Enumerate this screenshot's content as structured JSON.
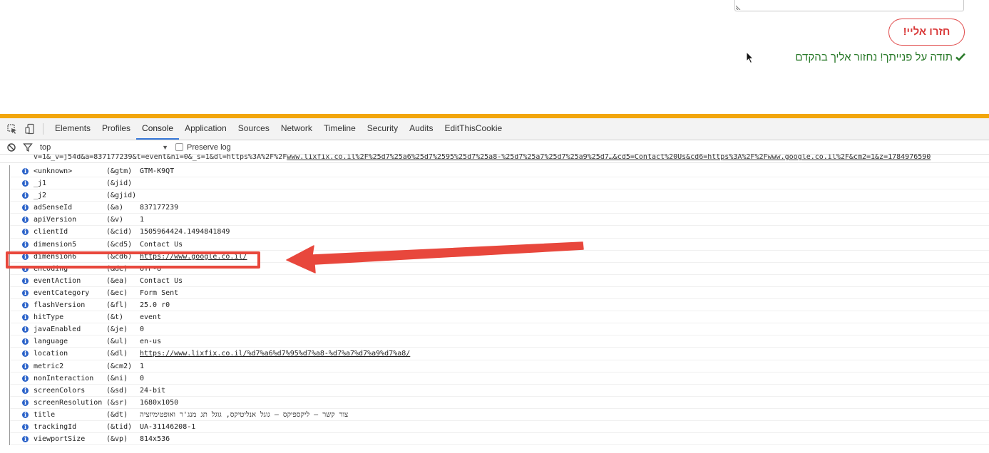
{
  "page": {
    "submit_label": "חזרו אליי!",
    "thanks_message": "תודה על פנייתך! נחזור אליך בהקדם",
    "colors": {
      "submit": "#d93a3a",
      "thanks": "#2a7a2a"
    }
  },
  "devtools": {
    "tabs": [
      "Elements",
      "Profiles",
      "Console",
      "Application",
      "Sources",
      "Network",
      "Timeline",
      "Security",
      "Audits",
      "EditThisCookie"
    ],
    "active_tab": "Console",
    "context": "top",
    "preserve_log_label": "Preserve log",
    "accent_color": "#f2a60c",
    "hit_line": {
      "prefix": "v=1&_v=j54d&a=837177239&t=event&ni=0&_s=1&dl=https%3A%2F%2F",
      "link": "www.lixfix.co.il%2F%25d7%25a6%25d7%2595%25d7%25a8-%25d7%25a7%25d7%25a9%25d7…&cd5=Contact%20Us&cd6=https%3A%2F%2Fwww.google.co.il%2F&cm2=1&z=1784976590"
    },
    "rows": [
      {
        "key": "<unknown>",
        "param": "(&gtm)",
        "value": "GTM-K9QT",
        "link": false
      },
      {
        "key": "_j1",
        "param": "(&jid)",
        "value": "",
        "link": false
      },
      {
        "key": "_j2",
        "param": "(&gjid)",
        "value": "",
        "link": false
      },
      {
        "key": "adSenseId",
        "param": "(&a)",
        "value": "837177239",
        "link": false
      },
      {
        "key": "apiVersion",
        "param": "(&v)",
        "value": "1",
        "link": false
      },
      {
        "key": "clientId",
        "param": "(&cid)",
        "value": "1505964424.1494841849",
        "link": false
      },
      {
        "key": "dimension5",
        "param": "(&cd5)",
        "value": "Contact Us",
        "link": false
      },
      {
        "key": "dimension6",
        "param": "(&cd6)",
        "value": "https://www.google.co.il/",
        "link": true
      },
      {
        "key": "encoding",
        "param": "(&de)",
        "value": "UTF-8",
        "link": false
      },
      {
        "key": "eventAction",
        "param": "(&ea)",
        "value": "Contact Us",
        "link": false
      },
      {
        "key": "eventCategory",
        "param": "(&ec)",
        "value": "Form Sent",
        "link": false
      },
      {
        "key": "flashVersion",
        "param": "(&fl)",
        "value": "25.0 r0",
        "link": false
      },
      {
        "key": "hitType",
        "param": "(&t)",
        "value": "event",
        "link": false
      },
      {
        "key": "javaEnabled",
        "param": "(&je)",
        "value": "0",
        "link": false
      },
      {
        "key": "language",
        "param": "(&ul)",
        "value": "en-us",
        "link": false
      },
      {
        "key": "location",
        "param": "(&dl)",
        "value": "https://www.lixfix.co.il/%d7%a6%d7%95%d7%a8-%d7%a7%d7%a9%d7%a8/",
        "link": true
      },
      {
        "key": "metric2",
        "param": "(&cm2)",
        "value": "1",
        "link": false
      },
      {
        "key": "nonInteraction",
        "param": "(&ni)",
        "value": "0",
        "link": false
      },
      {
        "key": "screenColors",
        "param": "(&sd)",
        "value": "24-bit",
        "link": false
      },
      {
        "key": "screenResolution",
        "param": "(&sr)",
        "value": "1680x1050",
        "link": false
      },
      {
        "key": "title",
        "param": "(&dt)",
        "value": "צור קשר – ליקספיקס – גוגל אנליטיקס, גוגל תג מנג'ר ואופטימיזציה",
        "link": false
      },
      {
        "key": "trackingId",
        "param": "(&tid)",
        "value": "UA-31146208-1",
        "link": false
      },
      {
        "key": "viewportSize",
        "param": "(&vp)",
        "value": "814x536",
        "link": false
      }
    ],
    "annotation_color": "#e8473c"
  }
}
